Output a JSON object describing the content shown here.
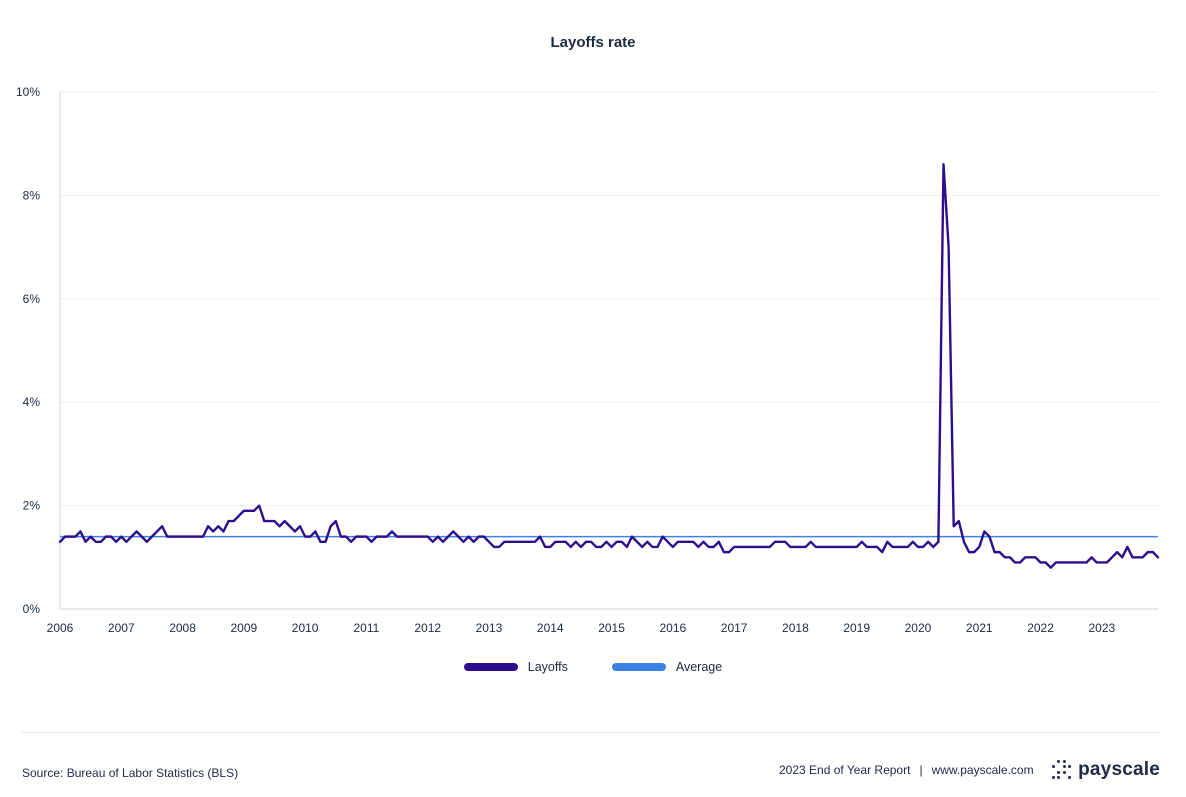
{
  "chart_data": {
    "type": "line",
    "title": "Layoffs rate",
    "xlabel": "",
    "ylabel": "",
    "x_start": "2006-01",
    "x_ticks": [
      "2006",
      "2007",
      "2008",
      "2009",
      "2010",
      "2011",
      "2012",
      "2013",
      "2014",
      "2015",
      "2016",
      "2017",
      "2018",
      "2019",
      "2020",
      "2021",
      "2022",
      "2023"
    ],
    "y_ticks": [
      "0%",
      "2%",
      "4%",
      "6%",
      "8%",
      "10%"
    ],
    "ylim": [
      0,
      10
    ],
    "grid": true,
    "legend_position": "bottom",
    "series": [
      {
        "name": "Layoffs",
        "color": "#2d0f8e",
        "values": [
          1.3,
          1.4,
          1.4,
          1.4,
          1.5,
          1.3,
          1.4,
          1.3,
          1.3,
          1.4,
          1.4,
          1.3,
          1.4,
          1.3,
          1.4,
          1.5,
          1.4,
          1.3,
          1.4,
          1.5,
          1.6,
          1.4,
          1.4,
          1.4,
          1.4,
          1.4,
          1.4,
          1.4,
          1.4,
          1.6,
          1.5,
          1.6,
          1.5,
          1.7,
          1.7,
          1.8,
          1.9,
          1.9,
          1.9,
          2.0,
          1.7,
          1.7,
          1.7,
          1.6,
          1.7,
          1.6,
          1.5,
          1.6,
          1.4,
          1.4,
          1.5,
          1.3,
          1.3,
          1.6,
          1.7,
          1.4,
          1.4,
          1.3,
          1.4,
          1.4,
          1.4,
          1.3,
          1.4,
          1.4,
          1.4,
          1.5,
          1.4,
          1.4,
          1.4,
          1.4,
          1.4,
          1.4,
          1.4,
          1.3,
          1.4,
          1.3,
          1.4,
          1.5,
          1.4,
          1.3,
          1.4,
          1.3,
          1.4,
          1.4,
          1.3,
          1.2,
          1.2,
          1.3,
          1.3,
          1.3,
          1.3,
          1.3,
          1.3,
          1.3,
          1.4,
          1.2,
          1.2,
          1.3,
          1.3,
          1.3,
          1.2,
          1.3,
          1.2,
          1.3,
          1.3,
          1.2,
          1.2,
          1.3,
          1.2,
          1.3,
          1.3,
          1.2,
          1.4,
          1.3,
          1.2,
          1.3,
          1.2,
          1.2,
          1.4,
          1.3,
          1.2,
          1.3,
          1.3,
          1.3,
          1.3,
          1.2,
          1.3,
          1.2,
          1.2,
          1.3,
          1.1,
          1.1,
          1.2,
          1.2,
          1.2,
          1.2,
          1.2,
          1.2,
          1.2,
          1.2,
          1.3,
          1.3,
          1.3,
          1.2,
          1.2,
          1.2,
          1.2,
          1.3,
          1.2,
          1.2,
          1.2,
          1.2,
          1.2,
          1.2,
          1.2,
          1.2,
          1.2,
          1.3,
          1.2,
          1.2,
          1.2,
          1.1,
          1.3,
          1.2,
          1.2,
          1.2,
          1.2,
          1.3,
          1.2,
          1.2,
          1.3,
          1.2,
          1.3,
          8.6,
          7.0,
          1.6,
          1.7,
          1.3,
          1.1,
          1.1,
          1.2,
          1.5,
          1.4,
          1.1,
          1.1,
          1.0,
          1.0,
          0.9,
          0.9,
          1.0,
          1.0,
          1.0,
          0.9,
          0.9,
          0.8,
          0.9,
          0.9,
          0.9,
          0.9,
          0.9,
          0.9,
          0.9,
          1.0,
          0.9,
          0.9,
          0.9,
          1.0,
          1.1,
          1.0,
          1.2,
          1.0,
          1.0,
          1.0,
          1.1,
          1.1,
          1.0
        ]
      },
      {
        "name": "Average",
        "color": "#3b82e6",
        "constant": 1.4
      }
    ]
  },
  "footer": {
    "source": "Source: Bureau of Labor Statistics (BLS)",
    "report": "2023 End of Year Report",
    "separator": "|",
    "url": "www.payscale.com",
    "brand": "payscale"
  }
}
